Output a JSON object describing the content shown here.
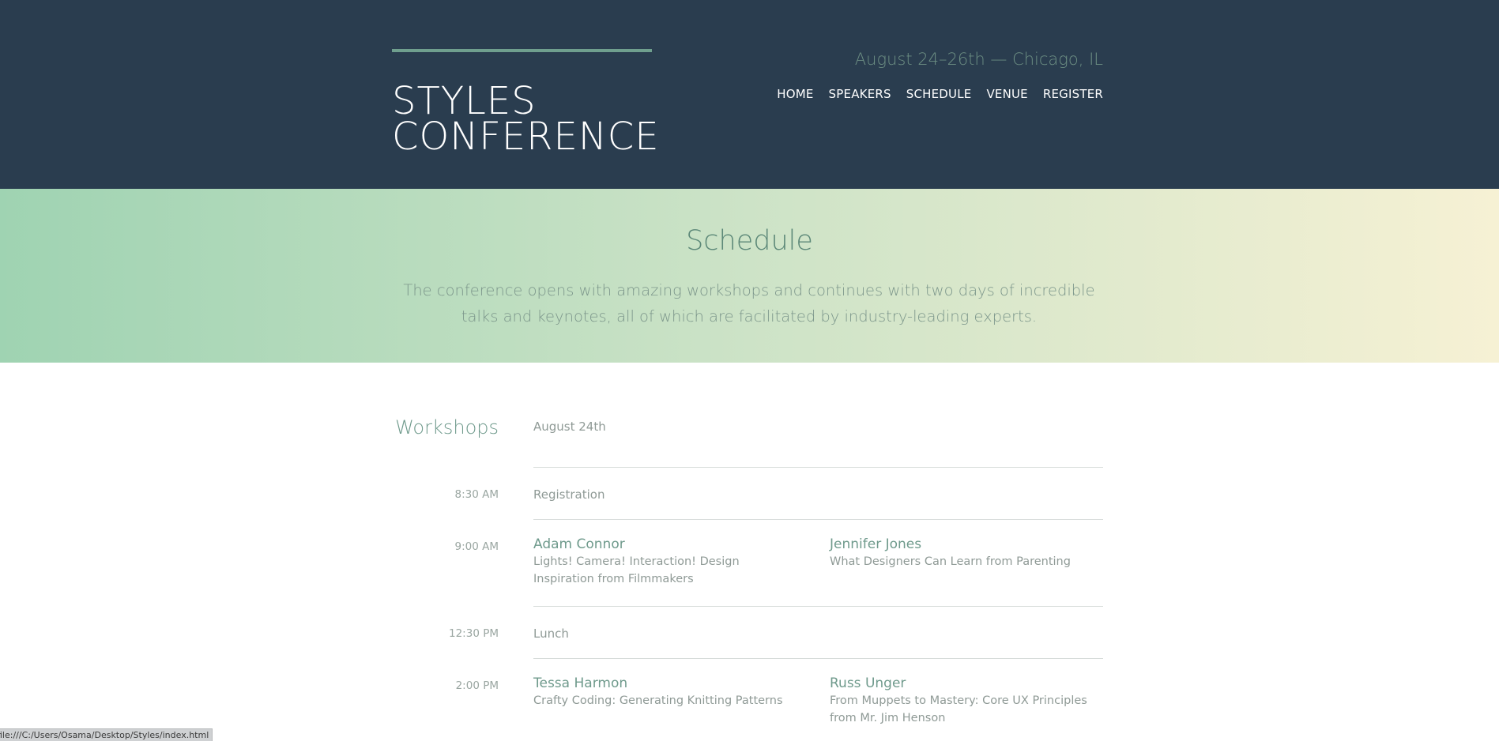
{
  "header": {
    "logo": "STYLES\nCONFERENCE",
    "tagline": "August 24–26th — Chicago, IL",
    "nav": [
      {
        "label": "HOME"
      },
      {
        "label": "SPEAKERS"
      },
      {
        "label": "SCHEDULE"
      },
      {
        "label": "VENUE"
      },
      {
        "label": "REGISTER"
      }
    ]
  },
  "hero": {
    "title": "Schedule",
    "description": "The conference opens with amazing workshops and continues with two days of incredible talks and keynotes, all of which are facilitated by industry-leading experts."
  },
  "schedule": {
    "section_title": "Workshops",
    "section_date": "August 24th",
    "rows": [
      {
        "time": "8:30 AM",
        "label": "Registration"
      },
      {
        "time": "9:00 AM",
        "talks": [
          {
            "speaker": "Adam Connor",
            "title": "Lights! Camera! Interaction! Design Inspiration from Filmmakers"
          },
          {
            "speaker": "Jennifer Jones",
            "title": "What Designers Can Learn from Parenting"
          }
        ]
      },
      {
        "time": "12:30 PM",
        "label": "Lunch"
      },
      {
        "time": "2:00 PM",
        "talks": [
          {
            "speaker": "Tessa Harmon",
            "title": "Crafty Coding: Generating Knitting Patterns"
          },
          {
            "speaker": "Russ Unger",
            "title": "From Muppets to Mastery: Core UX Principles from Mr. Jim Henson"
          }
        ]
      }
    ]
  },
  "status_bar": {
    "text": "file:///C:/Users/Osama/Desktop/Styles/index.html"
  },
  "colors": {
    "header_bg": "#2a3d4f",
    "accent": "#6f9a8c",
    "hero_gradient_start": "#9fd3b2",
    "hero_gradient_end": "#f6f1d4"
  }
}
